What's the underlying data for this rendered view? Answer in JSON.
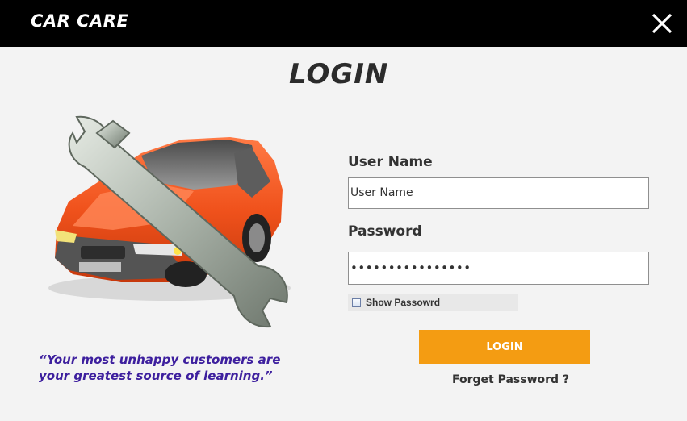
{
  "app": {
    "title": "CAR CARE"
  },
  "heading": "LOGIN",
  "quote": "“Your most unhappy customers are your greatest source of learning.”",
  "form": {
    "username_label": "User Name",
    "username_value": "User Name",
    "password_label": "Password",
    "password_value": "••••••••••••••••",
    "show_password_label": "Show Passowrd",
    "show_password_checked": false,
    "login_button": "LOGIN",
    "forget_link": "Forget Password ?"
  },
  "icons": {
    "close": "close-icon",
    "illustration": "car-wrench-illustration"
  },
  "colors": {
    "titlebar": "#000000",
    "background": "#f3f3f3",
    "button": "#f49c12",
    "quote": "#3d1f9e",
    "car": "#f0521c"
  }
}
